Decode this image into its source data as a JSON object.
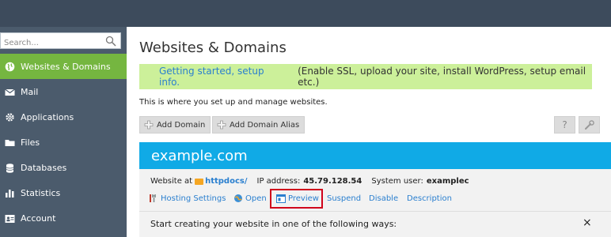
{
  "sidebar": {
    "search_placeholder": "Search...",
    "items": [
      {
        "label": "Websites & Domains",
        "icon": "globe-icon",
        "active": true
      },
      {
        "label": "Mail",
        "icon": "envelope-icon"
      },
      {
        "label": "Applications",
        "icon": "gear-icon"
      },
      {
        "label": "Files",
        "icon": "folder-icon"
      },
      {
        "label": "Databases",
        "icon": "database-icon"
      },
      {
        "label": "Statistics",
        "icon": "bar-chart-icon"
      },
      {
        "label": "Account",
        "icon": "account-icon"
      }
    ]
  },
  "main": {
    "title": "Websites & Domains",
    "banner": {
      "link": "Getting started, setup info.",
      "text": "(Enable SSL, upload your site, install WordPress, setup email etc.)"
    },
    "description": "This is where you set up and manage websites.",
    "toolbar": {
      "add_domain": "Add Domain",
      "add_domain_alias": "Add Domain Alias",
      "help": "?"
    }
  },
  "domain": {
    "name": "example.com",
    "website_at_label": "Website at",
    "website_path": "httpdocs/",
    "ip_label": "IP address:",
    "ip": "45.79.128.54",
    "user_label": "System user:",
    "user": "examplec",
    "actions": {
      "hosting_settings": "Hosting Settings",
      "open": "Open",
      "preview": "Preview",
      "suspend": "Suspend",
      "disable": "Disable",
      "description": "Description"
    },
    "start_text": "Start creating your website in one of the following ways:",
    "close": "×"
  },
  "colors": {
    "topbar": "#3d4b5c",
    "sidebar": "#4b5b6c",
    "active_nav": "#75b640",
    "banner": "#ccf09a",
    "domain_header": "#10aae6",
    "link": "#2a7fcf",
    "highlight": "#d0021b"
  }
}
